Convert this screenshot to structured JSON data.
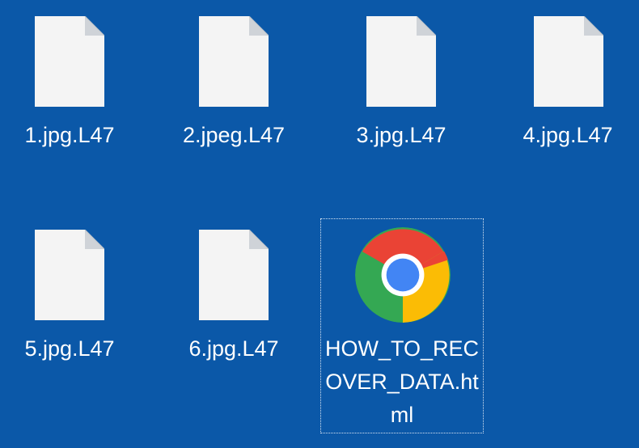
{
  "files": [
    {
      "name": "1.jpg.L47",
      "icon": "blank-file-icon"
    },
    {
      "name": "2.jpeg.L47",
      "icon": "blank-file-icon"
    },
    {
      "name": "3.jpg.L47",
      "icon": "blank-file-icon"
    },
    {
      "name": "4.jpg.L47",
      "icon": "blank-file-icon"
    },
    {
      "name": "5.jpg.L47",
      "icon": "blank-file-icon"
    },
    {
      "name": "6.jpg.L47",
      "icon": "blank-file-icon"
    },
    {
      "name": "HOW_TO_RECOVER_DATA.html",
      "icon": "chrome-icon",
      "selected": true
    }
  ],
  "colors": {
    "desktop_background": "#0b58a8",
    "file_page": "#f4f4f4",
    "label_text": "#ffffff"
  }
}
